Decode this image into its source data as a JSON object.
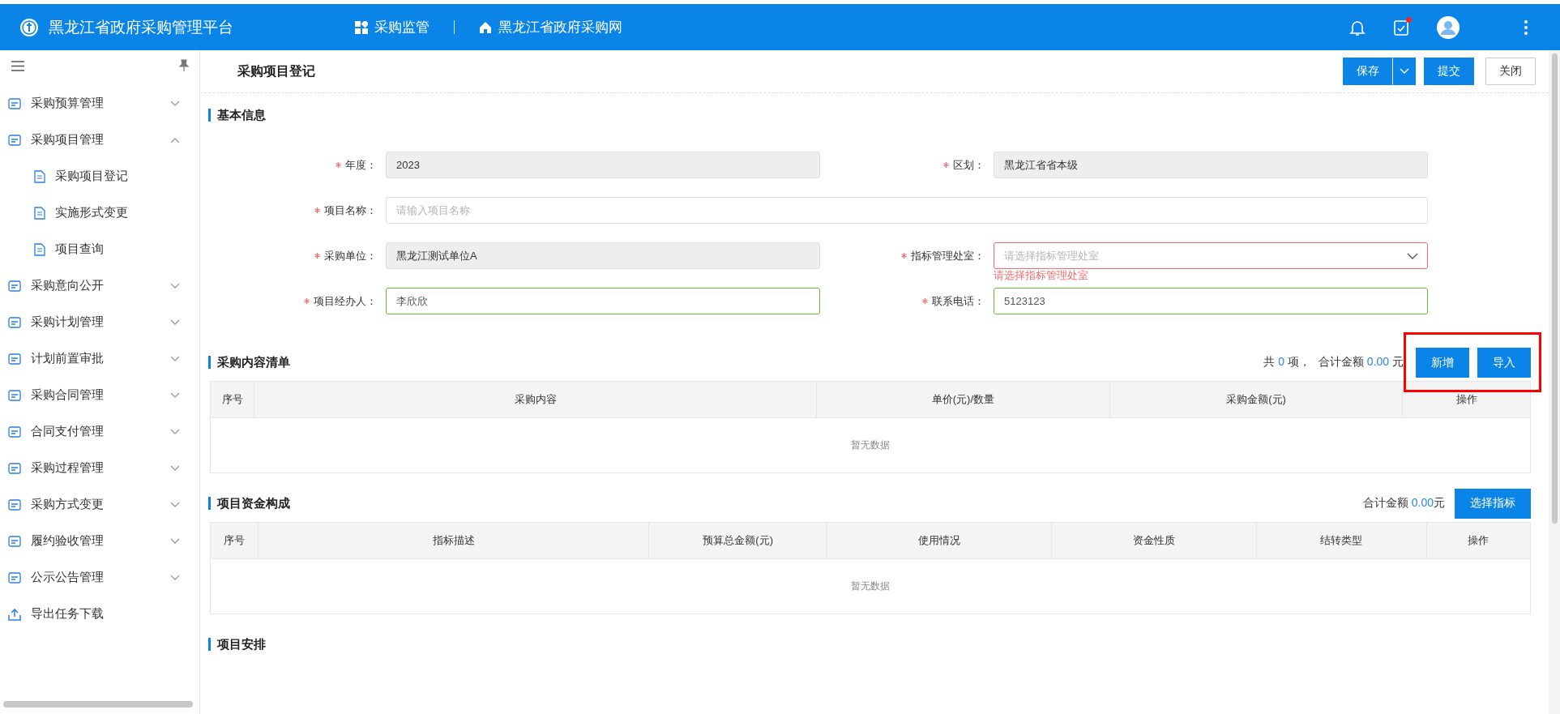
{
  "header": {
    "title": "黑龙江省政府采购管理平台",
    "nav": [
      {
        "label": "采购监管",
        "kind": "apps"
      },
      {
        "label": "黑龙江省政府采购网",
        "kind": "home"
      }
    ],
    "tasks_badge": true
  },
  "sidebar": {
    "items": [
      {
        "label": "采购预算管理",
        "kind": "group",
        "expanded": false
      },
      {
        "label": "采购项目管理",
        "kind": "group",
        "expanded": true,
        "children": [
          {
            "label": "采购项目登记"
          },
          {
            "label": "实施形式变更"
          },
          {
            "label": "项目查询"
          }
        ]
      },
      {
        "label": "采购意向公开",
        "kind": "group",
        "expanded": false
      },
      {
        "label": "采购计划管理",
        "kind": "group",
        "expanded": false
      },
      {
        "label": "计划前置审批",
        "kind": "group",
        "expanded": false
      },
      {
        "label": "采购合同管理",
        "kind": "group",
        "expanded": false
      },
      {
        "label": "合同支付管理",
        "kind": "group",
        "expanded": false
      },
      {
        "label": "采购过程管理",
        "kind": "group",
        "expanded": false
      },
      {
        "label": "采购方式变更",
        "kind": "group",
        "expanded": false
      },
      {
        "label": "履约验收管理",
        "kind": "group",
        "expanded": false
      },
      {
        "label": "公示公告管理",
        "kind": "group",
        "expanded": false
      },
      {
        "label": "导出任务下载",
        "kind": "link"
      }
    ]
  },
  "toolbar": {
    "title": "采购项目登记",
    "buttons": [
      {
        "label": "保存",
        "kind": "split"
      },
      {
        "label": "提交",
        "kind": "primary"
      },
      {
        "label": "关闭",
        "kind": "default"
      }
    ]
  },
  "basic_info": {
    "title": "基本信息",
    "fields": [
      {
        "label": "年度：",
        "required": true,
        "kind": "input",
        "disabled": true,
        "valid": false,
        "wide": false,
        "value": "2023"
      },
      {
        "label": "区划：",
        "required": true,
        "kind": "input",
        "disabled": true,
        "valid": false,
        "wide": false,
        "value": "黑龙江省省本级"
      },
      {
        "label": "项目名称：",
        "required": true,
        "kind": "input",
        "disabled": false,
        "valid": false,
        "wide": true,
        "placeholder": "请输入项目名称"
      },
      {
        "label": "采购单位：",
        "required": true,
        "kind": "input",
        "disabled": true,
        "valid": false,
        "wide": false,
        "value": "黑龙江测试单位A"
      },
      {
        "label": "指标管理处室：",
        "required": true,
        "kind": "select",
        "disabled": false,
        "valid": false,
        "wide": false,
        "placeholder": "请选择指标管理处室",
        "error": "请选择指标管理处室"
      },
      {
        "label": "项目经办人：",
        "required": true,
        "kind": "input",
        "disabled": false,
        "valid": true,
        "wide": false,
        "value": "李欣欣"
      },
      {
        "label": "联系电话：",
        "required": true,
        "kind": "input",
        "disabled": false,
        "valid": true,
        "wide": false,
        "value": "5123123"
      }
    ]
  },
  "sections": [
    {
      "title": "采购内容清单",
      "summary": {
        "count_prefix": "共",
        "count": "0",
        "count_suffix": "项，",
        "total_label": "合计金额",
        "total": "0.00",
        "total_suffix": "元"
      },
      "buttons": [
        "新增",
        "导入"
      ],
      "highlighted": true,
      "table": {
        "columns": [
          "序号",
          "采购内容",
          "单价(元)/数量",
          "采购金额(元)",
          "操作"
        ],
        "empty_text": "暂无数据"
      }
    },
    {
      "title": "项目资金构成",
      "summary": {
        "total_label": "合计金额",
        "total": "0.00",
        "total_suffix": "元"
      },
      "buttons": [
        "选择指标"
      ],
      "table": {
        "columns": [
          "序号",
          "指标描述",
          "预算总金额(元)",
          "使用情况",
          "资金性质",
          "结转类型",
          "操作"
        ],
        "empty_text": "暂无数据"
      }
    },
    {
      "title": "项目安排"
    }
  ]
}
